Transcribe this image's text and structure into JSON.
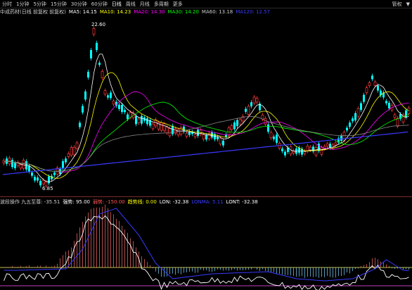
{
  "toolbar": {
    "items": [
      {
        "label": "分时",
        "active": false
      },
      {
        "label": "1分钟",
        "active": false
      },
      {
        "label": "5分钟",
        "active": false
      },
      {
        "label": "15分钟",
        "active": false
      },
      {
        "label": "30分钟",
        "active": false
      },
      {
        "label": "60分钟",
        "active": false
      },
      {
        "label": "日线",
        "active": true
      },
      {
        "label": "周线",
        "active": false
      },
      {
        "label": "月线",
        "active": false
      },
      {
        "label": "多周期",
        "active": false
      },
      {
        "label": "更多",
        "active": false
      }
    ],
    "right_labels": [
      "管权",
      "▼"
    ]
  },
  "main_legend": {
    "title": "中成药材(日线 前复权 前复权)",
    "items": [
      {
        "label": "MA5: 14.15",
        "color": "#ffffff"
      },
      {
        "label": "MA10: 14.23",
        "color": "#ffff00"
      },
      {
        "label": "MA20: 14.30",
        "color": "#ff00ff"
      },
      {
        "label": "MA30: 14.20",
        "color": "#00ff00"
      },
      {
        "label": "MA60: 13.18",
        "color": "#cccccc"
      },
      {
        "label": "MA120: 12.57",
        "color": "#3a3aff"
      }
    ]
  },
  "price_annotations": {
    "high_label": "22.60",
    "low_label": "6.85"
  },
  "indicator_legend": {
    "title": "波段操作 九五至尊: -35.51",
    "items": [
      {
        "label": "强势: 95.00",
        "color": "#ffffff"
      },
      {
        "label": "弱势: -150.00",
        "color": "#ff5555"
      },
      {
        "label": "趋势线: 0.00",
        "color": "#ffff00"
      },
      {
        "label": "LON: -32.38",
        "color": "#ffffff"
      },
      {
        "label": "LONMA: 5.11",
        "color": "#3a3aff"
      },
      {
        "label": "LONT: -32.38",
        "color": "#ffffff"
      }
    ]
  },
  "colors": {
    "up": "#ff3b3b",
    "down": "#00ffff",
    "bg": "#000000",
    "ma5": "#ffffff",
    "ma10": "#ffff00",
    "ma20": "#ff00ff",
    "ma30": "#00ff00",
    "ma120": "#3a3aff"
  }
}
